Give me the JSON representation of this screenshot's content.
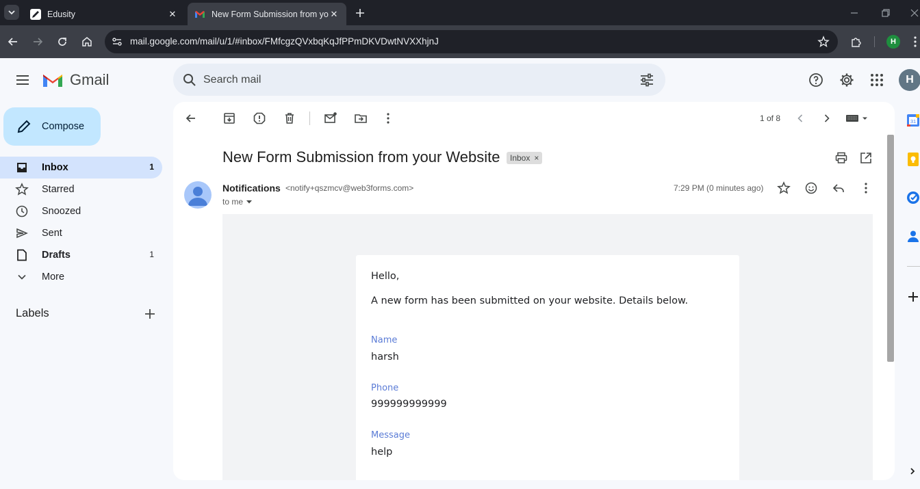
{
  "browser": {
    "tabs": [
      {
        "title": "Edusity",
        "active": false
      },
      {
        "title": "New Form Submission from your",
        "active": true
      }
    ],
    "url": "mail.google.com/mail/u/1/#inbox/FMfcgzQVxbqKqJfPPmDKVDwtNVXXhjnJ",
    "profile_initial": "H"
  },
  "gmail": {
    "app_name": "Gmail",
    "search_placeholder": "Search mail",
    "account_initial": "H",
    "compose_label": "Compose",
    "nav": [
      {
        "label": "Inbox",
        "count": "1",
        "icon": "inbox-icon"
      },
      {
        "label": "Starred",
        "count": "",
        "icon": "star-icon"
      },
      {
        "label": "Snoozed",
        "count": "",
        "icon": "clock-icon"
      },
      {
        "label": "Sent",
        "count": "",
        "icon": "send-icon"
      },
      {
        "label": "Drafts",
        "count": "1",
        "icon": "draft-icon"
      },
      {
        "label": "More",
        "count": "",
        "icon": "chevron-down-icon"
      }
    ],
    "labels_heading": "Labels"
  },
  "message": {
    "pager": "1 of 8",
    "subject": "New Form Submission from your Website",
    "label_chip": "Inbox",
    "sender_name": "Notifications",
    "sender_email": "<notify+qszmcv@web3forms.com>",
    "recipient": "to me",
    "time": "7:29 PM (0 minutes ago)",
    "body": {
      "greeting": "Hello,",
      "intro": "A new form has been submitted on your website. Details below.",
      "fields": [
        {
          "label": "Name",
          "value": "harsh"
        },
        {
          "label": "Phone",
          "value": "999999999999"
        },
        {
          "label": "Message",
          "value": "help"
        }
      ]
    }
  },
  "colors": {
    "compose_bg": "#c2e7ff",
    "active_nav_bg": "#d3e3fd",
    "field_label": "#5b7cd6",
    "page_bg": "#f6f8fc"
  }
}
